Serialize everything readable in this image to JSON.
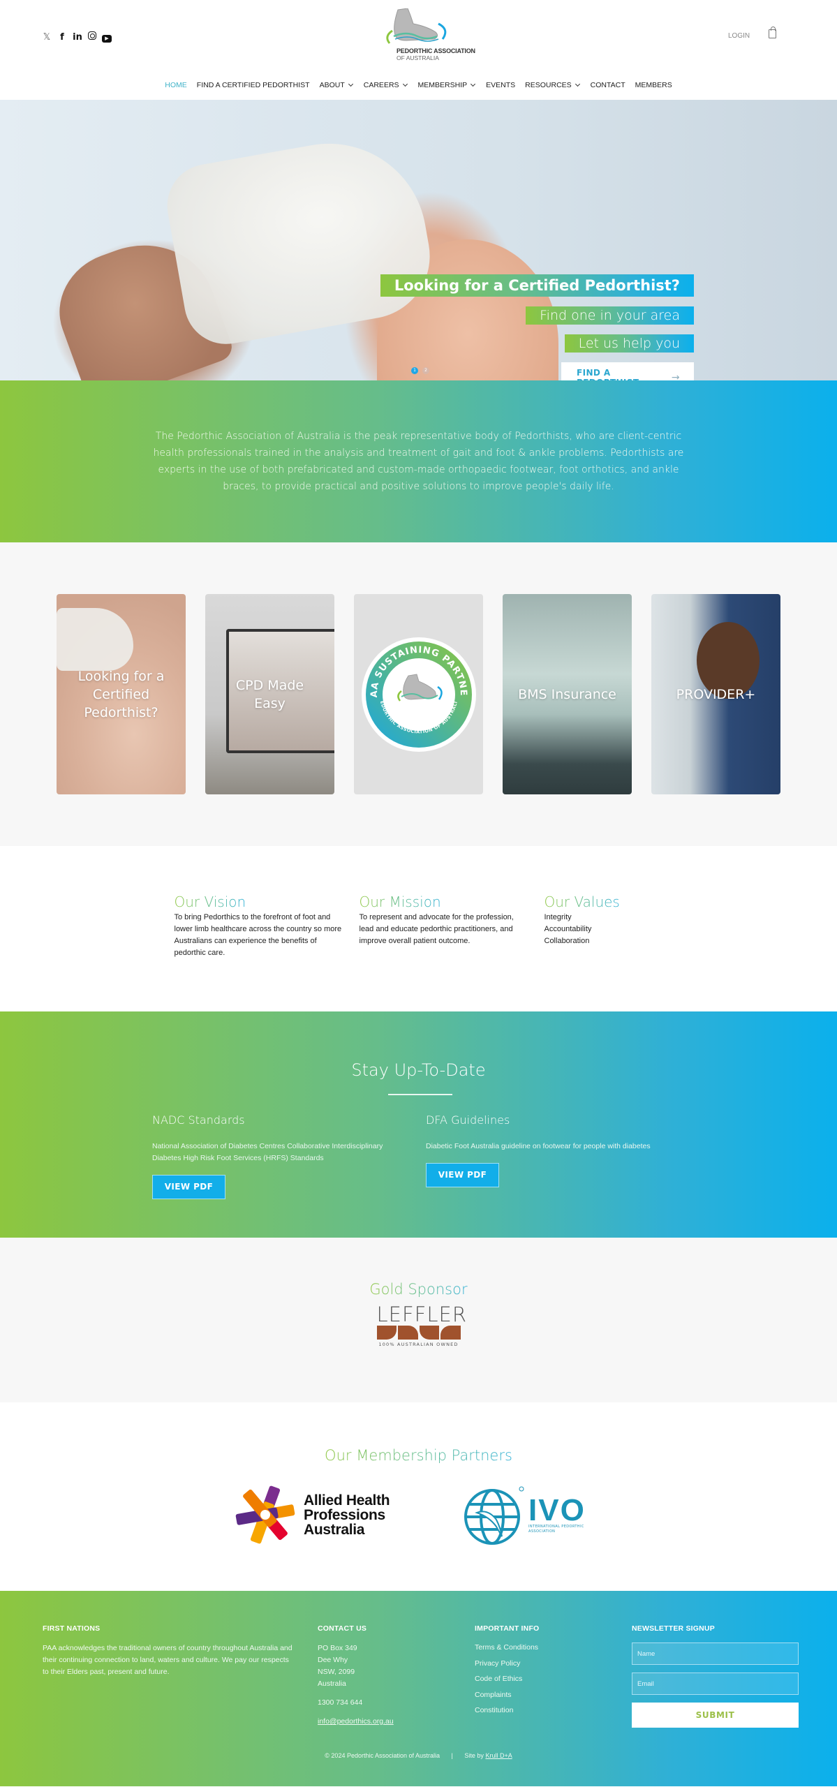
{
  "header": {
    "socials": [
      {
        "icon": "x-twitter-icon",
        "glyph": "𝕏"
      },
      {
        "icon": "facebook-icon",
        "glyph": "f"
      },
      {
        "icon": "linkedin-icon",
        "glyph": "in"
      },
      {
        "icon": "instagram-icon",
        "glyph": ""
      },
      {
        "icon": "youtube-icon",
        "glyph": "▶"
      }
    ],
    "logo_line1": "PEDORTHIC ASSOCIATION",
    "logo_line2": "OF AUSTRALIA",
    "login": "LOGIN",
    "cart_icon": "shopping-bag-icon"
  },
  "nav": {
    "items": [
      {
        "label": "HOME",
        "active": true,
        "dropdown": false
      },
      {
        "label": "FIND A CERTIFIED PEDORTHIST",
        "active": false,
        "dropdown": false
      },
      {
        "label": "ABOUT",
        "active": false,
        "dropdown": true
      },
      {
        "label": "CAREERS",
        "active": false,
        "dropdown": true
      },
      {
        "label": "MEMBERSHIP",
        "active": false,
        "dropdown": true
      },
      {
        "label": "EVENTS",
        "active": false,
        "dropdown": false
      },
      {
        "label": "RESOURCES",
        "active": false,
        "dropdown": true
      },
      {
        "label": "CONTACT",
        "active": false,
        "dropdown": false
      },
      {
        "label": "MEMBERS",
        "active": false,
        "dropdown": false
      }
    ]
  },
  "hero": {
    "headline": "Looking for a Certified Pedorthist?",
    "line2": "Find one in your area",
    "line3": "Let us help you",
    "cta": "FIND A PEDORTHIST",
    "cta_arrow": "→",
    "slides": [
      "1",
      "2"
    ],
    "active_slide": 1
  },
  "intro": {
    "text": "The Pedorthic Association of Australia is the peak representative body of Pedorthists, who are client-centric health professionals trained in the analysis and treatment of gait and foot & ankle problems. Pedorthists are experts in the use of both prefabricated and custom-made orthopaedic footwear, foot orthotics, and ankle braces, to provide practical and positive solutions to improve people's daily life."
  },
  "cards": [
    {
      "label": "Looking for a Certified Pedorthist?"
    },
    {
      "label": "CPD Made Easy"
    },
    {
      "label": "",
      "badge_top": "PAA SUSTAINING PARTNER",
      "badge_bottom": "PEDORTHIC ASSOCIATION OF AUSTRALIA"
    },
    {
      "label": "BMS Insurance"
    },
    {
      "label": "PROVIDER+"
    }
  ],
  "vision": {
    "vision_title": "Our Vision",
    "vision_text": "To bring Pedorthics to the forefront of foot and lower limb healthcare across the country so more Australians can experience the benefits of pedorthic care.",
    "mission_title": "Our Mission",
    "mission_text": "To represent and advocate for the profession, lead and educate pedorthic practitioners, and improve overall patient outcome.",
    "values_title": "Our Values",
    "values": [
      "Integrity",
      "Accountability",
      "Collaboration"
    ]
  },
  "stay": {
    "title": "Stay Up-To-Date",
    "docs": [
      {
        "title": "NADC Standards",
        "text": "National Association of Diabetes Centres Collaborative Interdisciplinary Diabetes High Risk Foot Services (HRFS) Standards",
        "button": "VIEW PDF"
      },
      {
        "title": "DFA Guidelines",
        "text": "Diabetic Foot Australia guideline on footwear for people with diabetes",
        "button": "VIEW PDF"
      }
    ]
  },
  "gold": {
    "title": "Gold Sponsor",
    "sponsor_name": "LEFFLER",
    "sponsor_tagline": "100% AUSTRALIAN OWNED"
  },
  "partners": {
    "title": "Our Membership Partners",
    "ahpa": [
      "Allied Health",
      "Professions",
      "Australia"
    ],
    "ivo_name": "IVO",
    "ivo_sub1": "INTERNATIONAL PEDORTHIC",
    "ivo_sub2": "ASSOCIATION"
  },
  "footer": {
    "first_nations_title": "FIRST NATIONS",
    "first_nations_text": "PAA acknowledges the traditional owners of country throughout Australia and their continuing connection to land, waters and culture. We pay our respects to their Elders past, present and future.",
    "contact_title": "CONTACT US",
    "address": [
      "PO Box 349",
      "Dee Why",
      "NSW, 2099",
      "Australia"
    ],
    "phone": "1300 734 644",
    "email": "info@pedorthics.org.au",
    "info_title": "IMPORTANT INFO",
    "info_links": [
      "Terms & Conditions",
      "Privacy Policy",
      "Code of Ethics",
      "Complaints",
      "Constitution"
    ],
    "newsletter_title": "NEWSLETTER SIGNUP",
    "name_placeholder": "Name",
    "email_placeholder": "Email",
    "submit": "SUBMIT",
    "copyright": "© 2024 Pedorthic Association of Australia",
    "separator": "|",
    "site_by": "Site by",
    "site_by_link": "Krull D+A"
  },
  "colors": {
    "green": "#8dc63f",
    "blue": "#0bb0ec",
    "nav_active": "#3fb2c8",
    "button_blue": "#12aee9",
    "submit_text": "#9cc04a"
  }
}
